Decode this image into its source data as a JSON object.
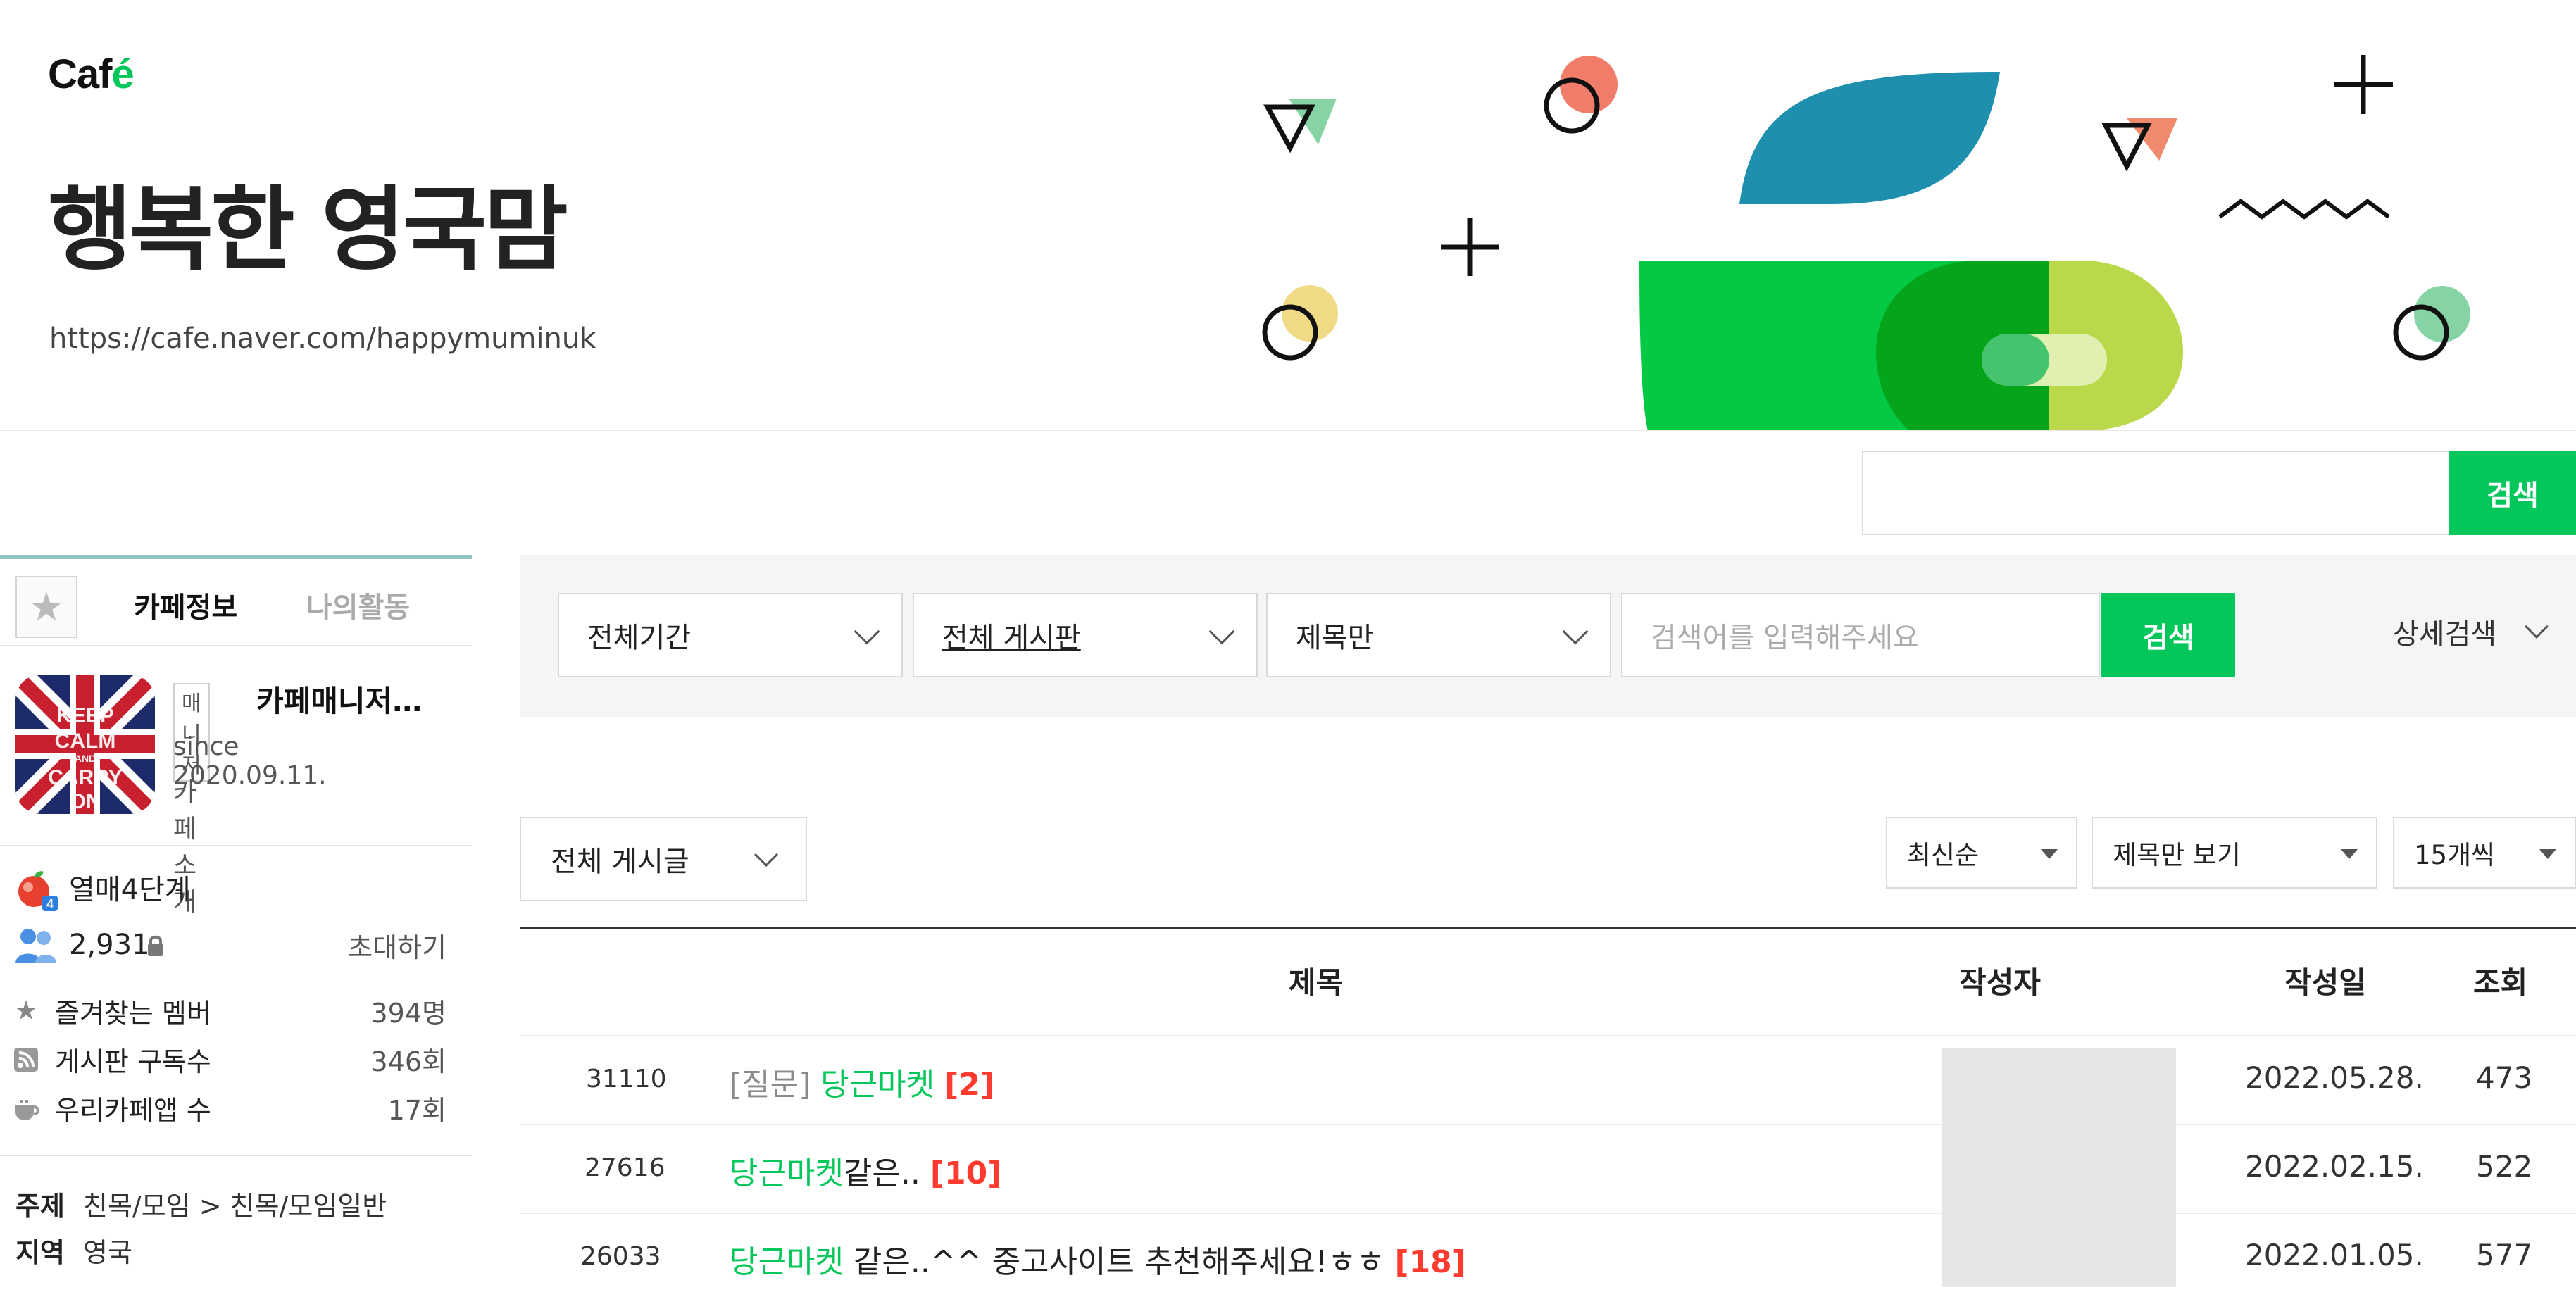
{
  "header": {
    "logo_main": "Caf",
    "logo_accent": "é",
    "cafe_name": "행복한 영국맘",
    "cafe_url": "https://cafe.naver.com/happymuminuk"
  },
  "top_search": {
    "button_label": "검색",
    "value": ""
  },
  "sidebar": {
    "tabs": [
      "카페정보",
      "나의활동"
    ],
    "favorite_icon": "star-icon",
    "manager_badge": "매니저",
    "manager_name": "카페매니저…",
    "since": "since 2020.09.11.",
    "intro_link": "카페소개",
    "avatar_text": "KEEP CALM AND CARRY ON",
    "level": "열매4단계",
    "member_count": "2,931",
    "invite_label": "초대하기",
    "stats": [
      {
        "icon": "star-icon",
        "label": "즐겨찾는 멤버",
        "value": "394명"
      },
      {
        "icon": "rss-icon",
        "label": "게시판 구독수",
        "value": "346회"
      },
      {
        "icon": "cup-icon",
        "label": "우리카페앱 수",
        "value": "17회"
      }
    ],
    "topic_key": "주제",
    "topic_value": "친목/모임 > 친목/모임일반",
    "region_key": "지역",
    "region_value": "영국"
  },
  "filters": {
    "period": "전체기간",
    "board": "전체 게시판",
    "scope": "제목만",
    "search_placeholder": "검색어를 입력해주세요",
    "search_button": "검색",
    "advanced": "상세검색"
  },
  "list_controls": {
    "board_select": "전체 게시글",
    "sort": "최신순",
    "view_mode": "제목만 보기",
    "page_size": "15개씩"
  },
  "table": {
    "headers": [
      "제목",
      "작성자",
      "작성일",
      "조회"
    ],
    "rows": [
      {
        "num": "31110",
        "category": "[질문]",
        "keyword": "당근마켓",
        "rest": "",
        "comments": "[2]",
        "date": "2022.05.28.",
        "views": "473"
      },
      {
        "num": "27616",
        "category": "",
        "keyword": "당근마켓",
        "rest": "같은..",
        "comments": "[10]",
        "date": "2022.02.15.",
        "views": "522"
      },
      {
        "num": "26033",
        "category": "",
        "keyword": "당근마켓",
        "rest": "같은..^^ 중고사이트 추천해주세요!ㅎㅎ",
        "comments": "[18]",
        "date": "2022.01.05.",
        "views": "577"
      }
    ]
  },
  "colors": {
    "accent_green": "#03c75a",
    "comment_red": "#ff3b30",
    "tab_border": "#8fc3c6"
  }
}
